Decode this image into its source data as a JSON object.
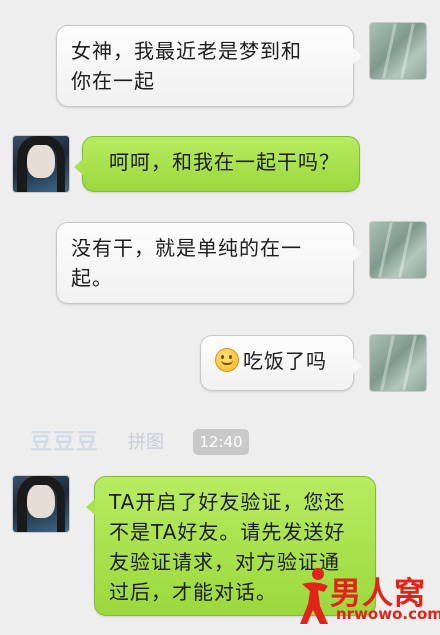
{
  "messages": [
    {
      "text_line1": "女神，我最近老是梦到和",
      "text_line2": "你在一起"
    },
    {
      "text": "呵呵，和我在一起干吗？"
    },
    {
      "text_line1": "没有干，就是单纯的在一",
      "text_line2": "起。"
    },
    {
      "text": "吃饭了吗",
      "emoji": "smiley-emoji"
    },
    {
      "text_line1": "TA开启了好友验证，您还",
      "text_line2": "不是TA好友。请先发送好",
      "text_line3": "友验证请求，对方验证通",
      "text_line4": "过后，才能对话。"
    }
  ],
  "timestamp": "12:40",
  "watermark_left": "豆豆豆",
  "watermark_left_sub": "拼图",
  "logo": {
    "name": "男人窝",
    "url": "nrwowo.com"
  },
  "colors": {
    "background": "#eeeeee",
    "incoming_bubble": "#a9e24e",
    "outgoing_bubble": "#f7f7f7",
    "logo_red": "#e2231a"
  }
}
